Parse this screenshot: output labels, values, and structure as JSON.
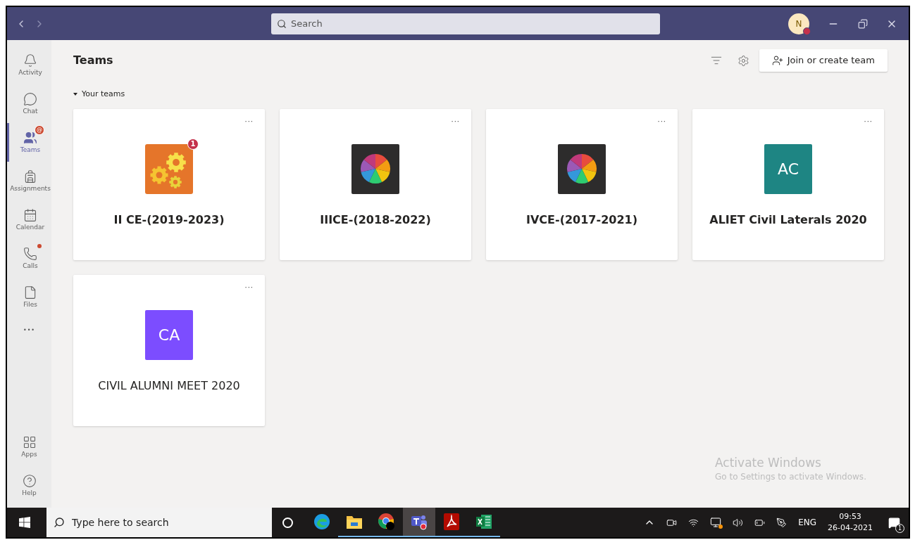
{
  "search": {
    "placeholder": "Search"
  },
  "avatar": {
    "initial": "N"
  },
  "sidebar": {
    "items": [
      {
        "label": "Activity",
        "selected": false,
        "unread": false
      },
      {
        "label": "Chat",
        "selected": false,
        "unread": false
      },
      {
        "label": "Teams",
        "selected": true,
        "unread": false,
        "badge": "@"
      },
      {
        "label": "Assignments",
        "selected": false,
        "unread": false
      },
      {
        "label": "Calendar",
        "selected": false,
        "unread": false
      },
      {
        "label": "Calls",
        "selected": false,
        "unread": true
      },
      {
        "label": "Files",
        "selected": false,
        "unread": false
      }
    ],
    "more": "•••",
    "bottom_items": [
      {
        "label": "Apps"
      },
      {
        "label": "Help"
      }
    ]
  },
  "header": {
    "title": "Teams",
    "join_button": "Join or create team"
  },
  "section": {
    "label": "Your teams",
    "expanded": true
  },
  "teams": [
    {
      "name": "II CE-(2019-2023)",
      "kind": "gears",
      "bold": true,
      "badge": "1",
      "menu": "···"
    },
    {
      "name": "IIICE-(2018-2022)",
      "kind": "wheel",
      "bold": true,
      "menu": "···"
    },
    {
      "name": "IVCE-(2017-2021)",
      "kind": "wheel",
      "bold": true,
      "menu": "···"
    },
    {
      "name": "ALIET Civil Laterals 2020",
      "kind": "initials",
      "initials": "AC",
      "color": "#1e8583",
      "bold": true,
      "menu": "···"
    },
    {
      "name": "CIVIL ALUMNI MEET 2020",
      "kind": "initials",
      "initials": "CA",
      "color": "#7c4dff",
      "bold": false,
      "menu": "···"
    }
  ],
  "activation": {
    "title": "Activate Windows",
    "subtitle": "Go to Settings to activate Windows."
  },
  "taskbar": {
    "search_placeholder": "Type here to search",
    "apps": [
      {
        "kind": "edge",
        "running": false,
        "selected": false
      },
      {
        "kind": "explorer",
        "running": true,
        "selected": false
      },
      {
        "kind": "chrome",
        "running": true,
        "selected": false
      },
      {
        "kind": "teams",
        "running": true,
        "selected": true
      },
      {
        "kind": "acrobat",
        "running": true,
        "selected": false
      },
      {
        "kind": "excel",
        "running": true,
        "selected": false
      }
    ],
    "language": "ENG",
    "time": "09:53",
    "date": "26-04-2021",
    "notifications": "1"
  }
}
